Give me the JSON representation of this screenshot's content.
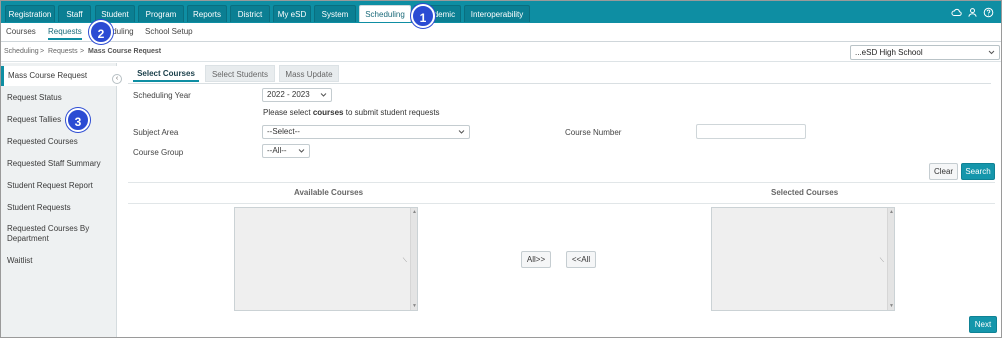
{
  "topnav": {
    "tabs": [
      "Registration",
      "Staff",
      "Student",
      "Program",
      "Reports",
      "District",
      "My eSD",
      "System",
      "Scheduling",
      "Academic",
      "Interoperability"
    ],
    "active": "Scheduling",
    "icons": [
      "cloud-icon",
      "user-icon",
      "help-icon"
    ]
  },
  "subnav": {
    "items": [
      "Courses",
      "Requests",
      "Scheduling",
      "School Setup"
    ],
    "active": "Requests"
  },
  "breadcrumb": {
    "items": [
      "Scheduling",
      "Requests",
      "Mass Course Request"
    ],
    "separator": ">"
  },
  "school_select": {
    "value": "...eSD High School"
  },
  "sidebar": {
    "items": [
      "Mass Course Request",
      "Request Status",
      "Request Tallies",
      "Requested Courses",
      "Requested Staff Summary",
      "Student Request Report",
      "Student Requests",
      "Requested Courses By Department",
      "Waitlist"
    ],
    "active": "Mass Course Request",
    "collapse_glyph": "‹"
  },
  "content_tabs": {
    "items": [
      "Select Courses",
      "Select Students",
      "Mass Update"
    ],
    "active": "Select Courses"
  },
  "form": {
    "scheduling_year_label": "Scheduling Year",
    "scheduling_year_value": "2022 - 2023",
    "note_pre": "Please select ",
    "note_bold": "courses",
    "note_post": " to submit student requests",
    "subject_area_label": "Subject Area",
    "subject_area_value": "--Select--",
    "course_number_label": "Course Number",
    "course_number_value": "",
    "course_group_label": "Course Group",
    "course_group_value": "--All--"
  },
  "buttons": {
    "clear": "Clear",
    "search": "Search",
    "all_right": "All>>",
    "all_left": "<<All",
    "next": "Next"
  },
  "lists": {
    "available_header": "Available Courses",
    "selected_header": "Selected Courses"
  },
  "callouts": [
    "1",
    "2",
    "3"
  ],
  "colors": {
    "accent": "#0e8ea3",
    "primary_button": "#1596ab",
    "callout": "#2b4bd3"
  }
}
